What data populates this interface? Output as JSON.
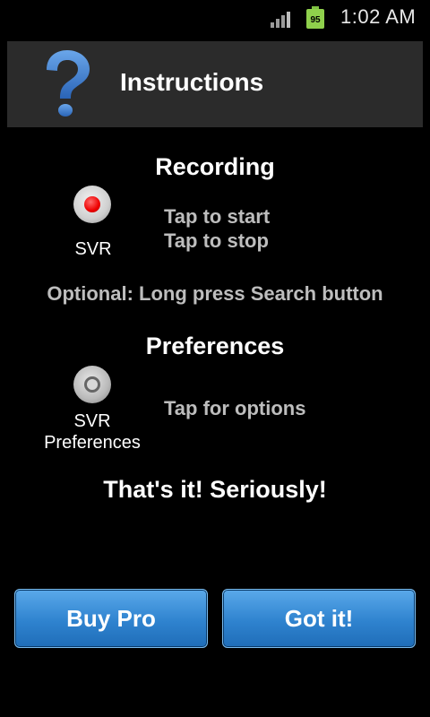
{
  "status_bar": {
    "time": "1:02 AM",
    "battery_level": "95",
    "icons": [
      "signal-icon",
      "battery-icon"
    ]
  },
  "header": {
    "title": "Instructions",
    "icon": "question-mark-icon"
  },
  "recording": {
    "title": "Recording",
    "button_label": "SVR",
    "line1": "Tap to start",
    "line2": "Tap to stop",
    "optional": "Optional: Long press Search button"
  },
  "preferences": {
    "title": "Preferences",
    "button_label_line1": "SVR",
    "button_label_line2": "Preferences",
    "hint": "Tap for options"
  },
  "closing": "That's it! Seriously!",
  "buttons": {
    "buy_pro": "Buy Pro",
    "got_it": "Got it!"
  },
  "colors": {
    "background": "#000000",
    "header_bg": "#2b2b2b",
    "button_blue": "#2f83cf",
    "question_blue": "#3d7fd1"
  }
}
